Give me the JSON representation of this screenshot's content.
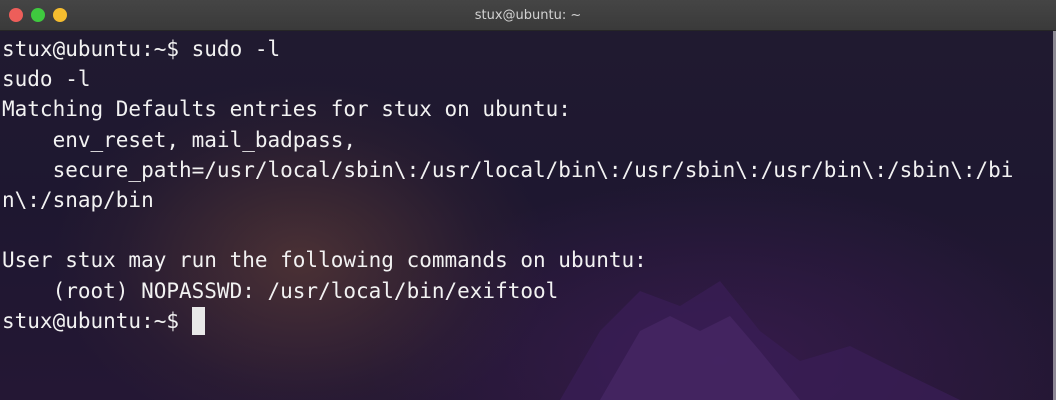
{
  "window": {
    "title": "stux@ubuntu: ~",
    "controls": [
      "close-button",
      "minimize-button",
      "maximize-button"
    ]
  },
  "terminal": {
    "lines": [
      "stux@ubuntu:~$ sudo -l",
      "sudo -l",
      "Matching Defaults entries for stux on ubuntu:",
      "    env_reset, mail_badpass,",
      "    secure_path=/usr/local/sbin\\:/usr/local/bin\\:/usr/sbin\\:/usr/bin\\:/sbin\\:/bi",
      "n\\:/snap/bin",
      "",
      "User stux may run the following commands on ubuntu:",
      "    (root) NOPASSWD: /usr/local/bin/exiftool"
    ],
    "prompt": "stux@ubuntu:~$ "
  },
  "colors": {
    "text": "#f2f2f2",
    "close": "#ed5e5a",
    "minimize": "#3fc93f",
    "maximize": "#f5bd2f"
  }
}
